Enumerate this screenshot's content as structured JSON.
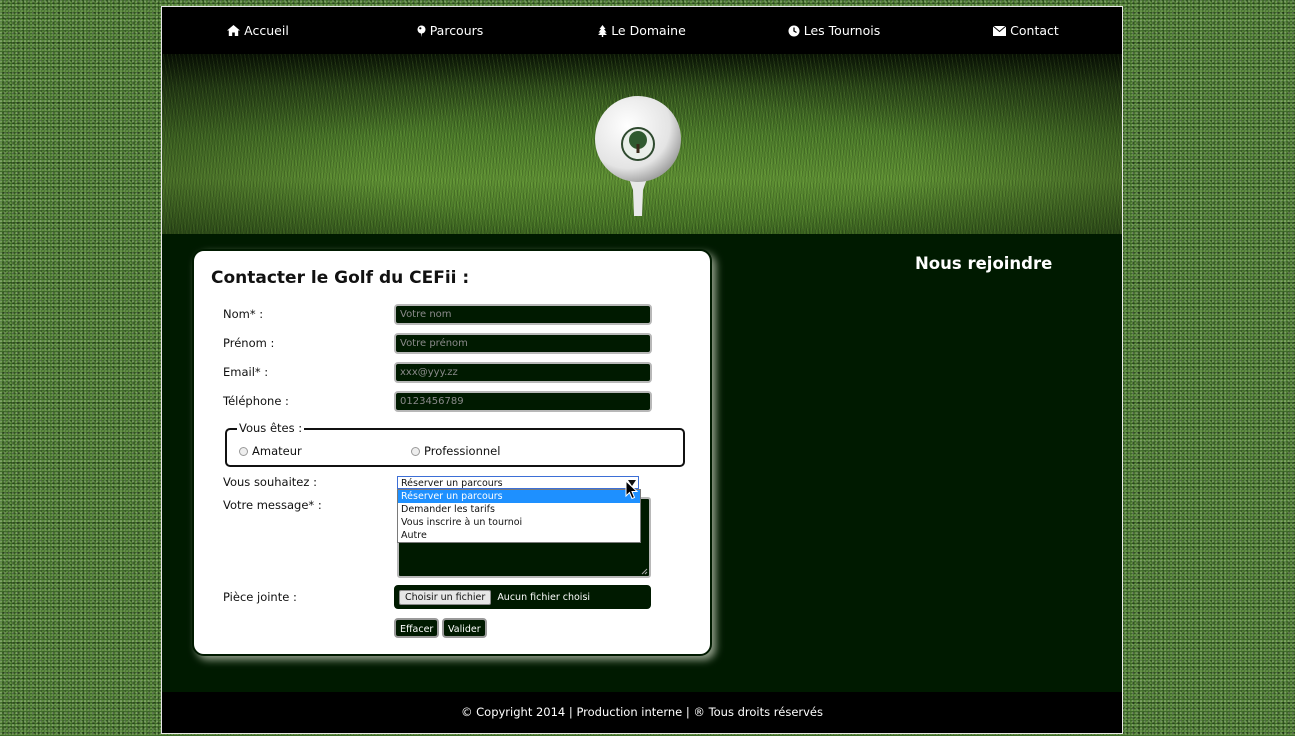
{
  "nav": {
    "items": [
      {
        "label": "Accueil",
        "icon": "home-icon"
      },
      {
        "label": "Parcours",
        "icon": "map-pin-icon"
      },
      {
        "label": "Le Domaine",
        "icon": "tree-icon"
      },
      {
        "label": "Les Tournois",
        "icon": "clock-icon"
      },
      {
        "label": "Contact",
        "icon": "envelope-icon"
      }
    ]
  },
  "form": {
    "title": "Contacter le Golf du CEFii :",
    "fields": {
      "nom": {
        "label": "Nom* :",
        "placeholder": "Votre nom"
      },
      "prenom": {
        "label": "Prénom :",
        "placeholder": "Votre prénom"
      },
      "email": {
        "label": "Email* :",
        "placeholder": "xxx@yyy.zz"
      },
      "telephone": {
        "label": "Téléphone :",
        "placeholder": "0123456789"
      }
    },
    "status": {
      "legend": "Vous êtes :",
      "options": [
        "Amateur",
        "Professionnel"
      ]
    },
    "wish": {
      "label": "Vous souhaitez :",
      "selected": "Réserver un parcours",
      "options": [
        "Réserver un parcours",
        "Demander les tarifs",
        "Vous inscrire à un tournoi",
        "Autre"
      ]
    },
    "message_label": "Votre message* :",
    "attachment": {
      "label": "Pièce jointe :",
      "button": "Choisir un fichier",
      "status": "Aucun fichier choisi"
    },
    "buttons": {
      "reset": "Effacer",
      "submit": "Valider"
    }
  },
  "aside": {
    "title": "Nous rejoindre"
  },
  "footer": {
    "text": "© Copyright 2014 | Production interne | ® Tous droits réservés"
  },
  "colors": {
    "site_bg": "#001a00",
    "nav_bg": "#000000",
    "accent": "#1e90ff"
  }
}
